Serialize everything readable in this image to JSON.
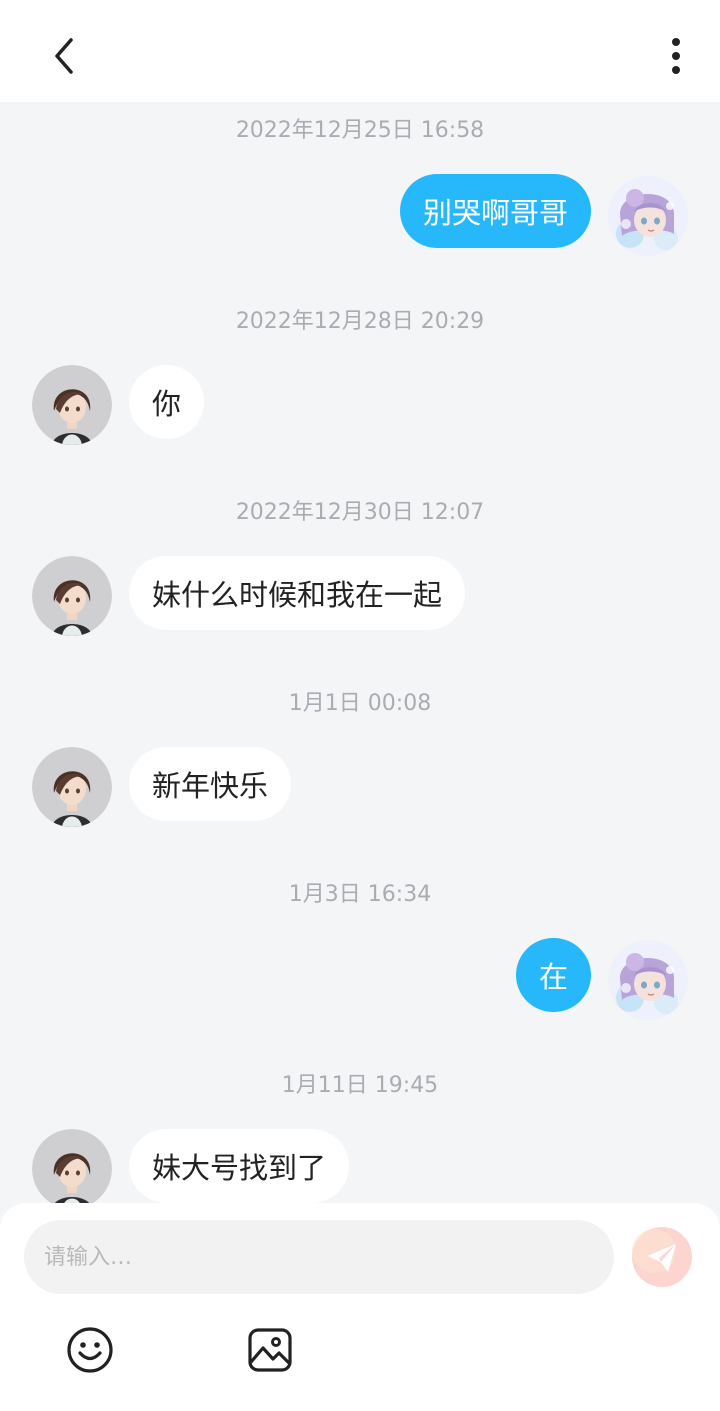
{
  "header": {
    "back_icon": "chevron-left-icon",
    "more_icon": "vertical-dots-icon"
  },
  "messages": [
    {
      "timestamp": "2022年12月25日 16:58",
      "sender": "me",
      "text": "别哭啊哥哥"
    },
    {
      "timestamp": "2022年12月28日 20:29",
      "sender": "other",
      "text": "你"
    },
    {
      "timestamp": "2022年12月30日 12:07",
      "sender": "other",
      "text": "妹什么时候和我在一起"
    },
    {
      "timestamp": "1月1日 00:08",
      "sender": "other",
      "text": "新年快乐"
    },
    {
      "timestamp": "1月3日 16:34",
      "sender": "me",
      "text": "在"
    },
    {
      "timestamp": "1月11日 19:45",
      "sender": "other",
      "text": "妹大号找到了"
    }
  ],
  "composer": {
    "placeholder": "请输入…",
    "send_icon": "paper-plane-icon",
    "tools": [
      {
        "icon": "emoji-smile-icon"
      },
      {
        "icon": "image-icon"
      }
    ]
  },
  "colors": {
    "outgoing_bubble": "#27b7fb",
    "incoming_bubble": "#ffffff",
    "background": "#f4f5f7",
    "send_button": "#fbc9c9"
  }
}
